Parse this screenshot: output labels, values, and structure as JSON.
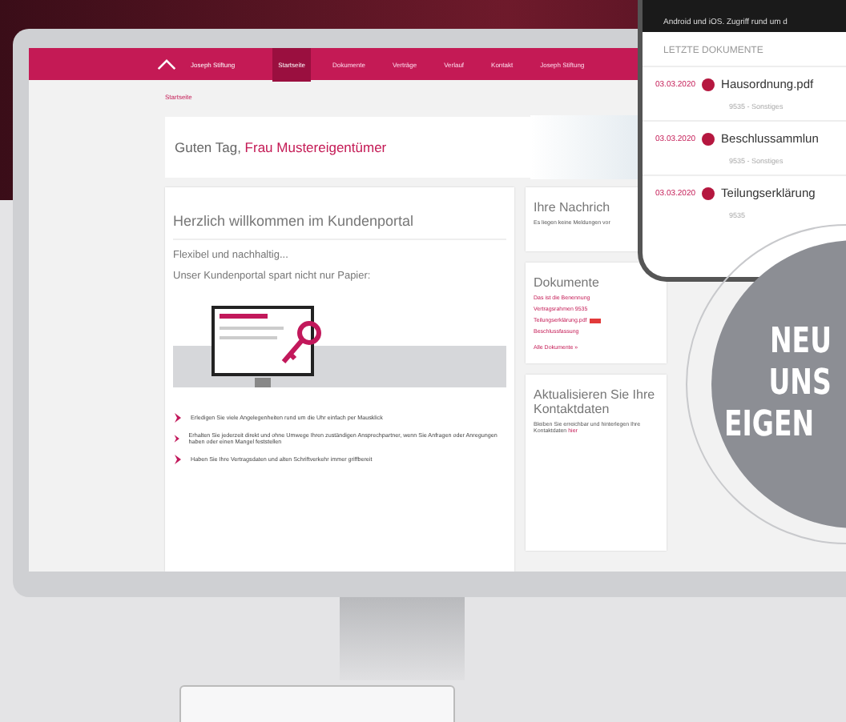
{
  "portal": {
    "logo": "Joseph Stiftung",
    "nav": [
      {
        "label": "Startseite",
        "selected": true
      },
      {
        "label": "Dokumente",
        "selected": false
      },
      {
        "label": "Verträge",
        "selected": false
      },
      {
        "label": "Verlauf",
        "selected": false
      },
      {
        "label": "Kontakt",
        "selected": false
      },
      {
        "label": "Joseph Stiftung",
        "selected": false
      }
    ],
    "breadcrumb": "Startseite",
    "greeting": "Guten Tag, **Frau Mustereigentümer**",
    "welcome": {
      "title": "Herzlich willkommen im Kundenportal",
      "lines": [
        "Flexibel und nachhaltig...",
        "Unser Kundenportal spart nicht nur Papier:"
      ],
      "bullets": [
        "Erledigen Sie viele Angelegenheiten rund um die Uhr einfach per Mausklick",
        "Erhalten Sie jederzeit direkt und ohne Umwege Ihren zuständigen Ansprechpartner, wenn Sie Anfragen oder Anregungen haben oder einen Mangel feststellen",
        "Haben Sie Ihre Vertragsdaten und alten Schriftverkehr immer griffbereit"
      ]
    },
    "messages": {
      "title": "Ihre Nachrich",
      "text": "Es liegen keine Meldungen vor"
    },
    "documents": {
      "title": "Dokumente",
      "items": [
        {
          "label": "Das ist die Benennung",
          "new": false
        },
        {
          "label": "Vertragsrahmen 9535",
          "new": false
        },
        {
          "label": "Teilungserklärung.pdf",
          "new": true
        },
        {
          "label": "Beschlussfassung",
          "new": false
        }
      ],
      "link": "Alle Dokumente »"
    },
    "contact": {
      "title": "Aktualisieren Sie Ihre Kontaktdaten",
      "text": "Bleiben Sie erreichbar und hinterlegen Ihre Kontaktdaten **hier**"
    }
  },
  "phone": {
    "banner": "Android und iOS. Zugriff rund um d",
    "heading": "LETZTE DOKUMENTE",
    "rows": [
      {
        "date": "03.03.2020",
        "name": "Hausordnung.pdf",
        "meta": "9535 - Sonstiges",
        "color": "#b5173f"
      },
      {
        "date": "03.03.2020",
        "name": "Beschlussammlun",
        "meta": "9535 - Sonstiges",
        "color": "#b5173f"
      },
      {
        "date": "03.03.2020",
        "name": "Teilungserklärung",
        "meta": "9535",
        "color": "#b5173f"
      }
    ]
  },
  "badge": {
    "lines": [
      "NEU",
      "UNS",
      "EIGEN"
    ]
  }
}
